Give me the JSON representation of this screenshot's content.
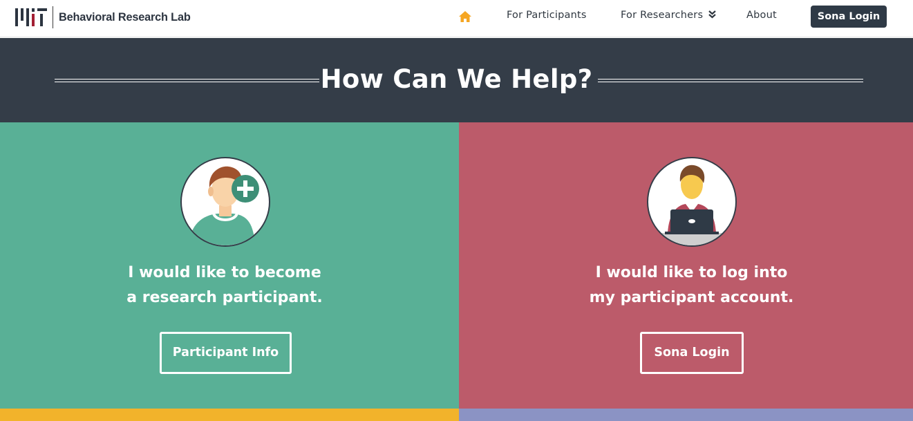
{
  "brand": {
    "logo_icon": "mit-logo",
    "name": "Behavioral Research Lab"
  },
  "nav": {
    "home_icon": "home-icon",
    "home_color": "#f5a623",
    "links": [
      {
        "label": "For Participants"
      },
      {
        "label": "For Researchers",
        "dropdown_icon": "double-chevron-down-icon"
      },
      {
        "label": "About"
      }
    ],
    "login_button": "Sona Login"
  },
  "hero": {
    "title": "How Can We Help?",
    "background": "#343d48"
  },
  "panels": [
    {
      "color": "#59b096",
      "illustration": "person-plus-icon",
      "line1": "I would like to become",
      "line2": "a research participant.",
      "button": "Participant Info"
    },
    {
      "color": "#bc5b6a",
      "illustration": "person-laptop-icon",
      "line1": "I would like to log into",
      "line2": "my participant account.",
      "button": "Sona Login"
    }
  ],
  "strips": {
    "left_color": "#f2b32b",
    "right_color": "#8b93c4"
  }
}
